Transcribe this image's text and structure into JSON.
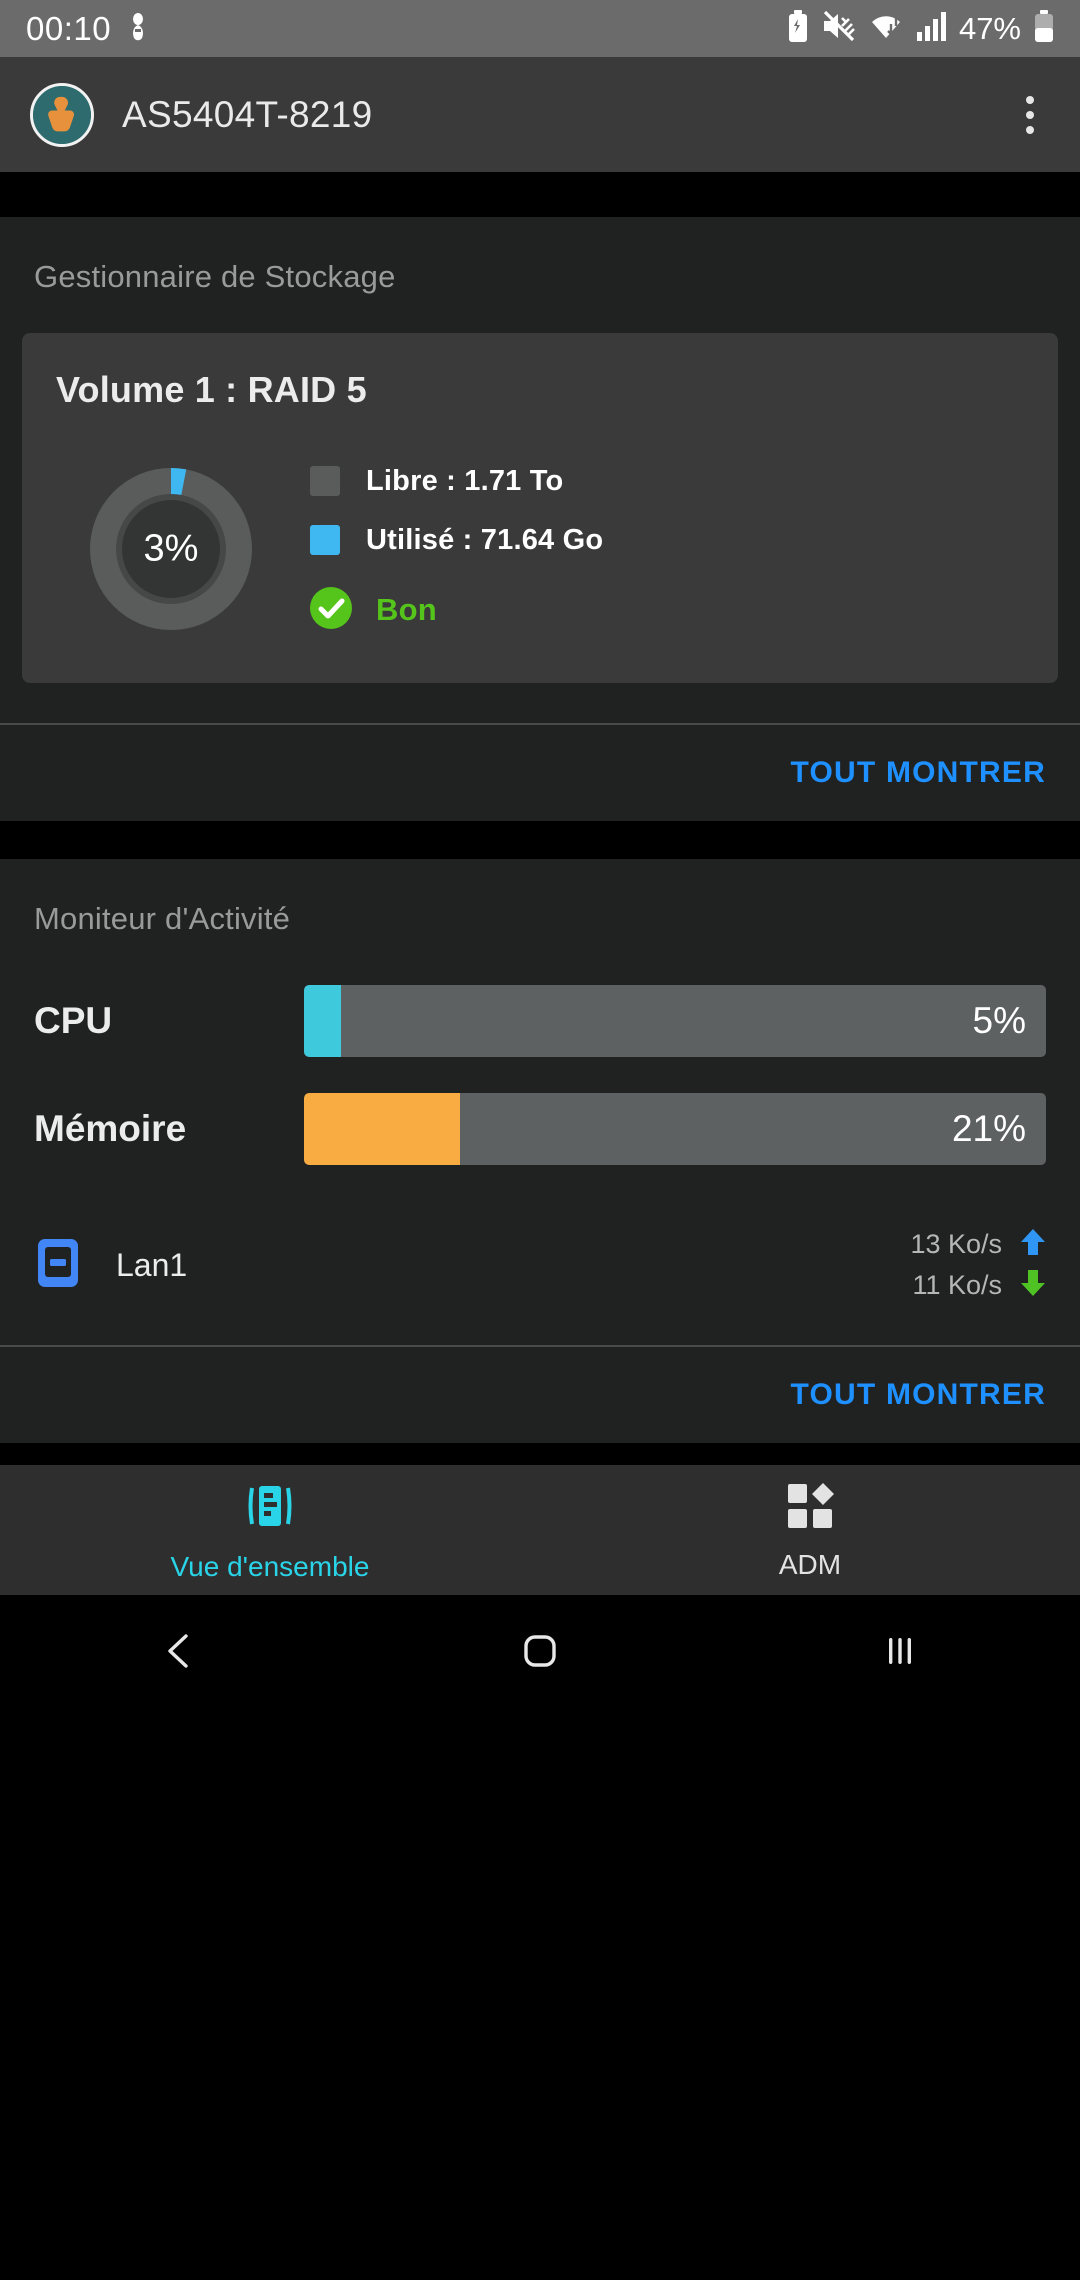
{
  "status_bar": {
    "time": "00:10",
    "battery_percent": "47%",
    "icons": [
      "do-not-disturb-icon",
      "battery-saver-icon",
      "mute-icon",
      "wifi-icon",
      "signal-icon",
      "battery-icon"
    ]
  },
  "app_bar": {
    "title": "AS5404T-8219",
    "avatar_name": "asustor-avatar",
    "menu_name": "overflow-menu-button"
  },
  "storage": {
    "section_title": "Gestionnaire de Stockage",
    "volume_title": "Volume 1 : RAID 5",
    "donut_percent_label": "3%",
    "legend": [
      {
        "label": "Libre : 1.71 To",
        "color": "#5a5c5c"
      },
      {
        "label": "Utilisé : 71.64 Go",
        "color": "#3fb8f2"
      }
    ],
    "status_label": "Bon",
    "status_color": "#55c41b",
    "show_all_label": "TOUT MONTRER"
  },
  "activity": {
    "section_title": "Moniteur d'Activité",
    "meters": [
      {
        "label": "CPU",
        "value_label": "5%",
        "percent": 5,
        "color": "#3fc9dd"
      },
      {
        "label": "Mémoire",
        "value_label": "21%",
        "percent": 21,
        "color": "#f8ac41"
      }
    ],
    "network": {
      "icon_name": "lan-port-icon",
      "name": "Lan1",
      "upload_rate": "13 Ko/s",
      "download_rate": "11 Ko/s",
      "upload_color": "#2f96f5",
      "download_color": "#4fc224"
    },
    "show_all_label": "TOUT MONTRER"
  },
  "bottom_nav": {
    "items": [
      {
        "label": "Vue d'ensemble",
        "icon": "overview-dashboard-icon",
        "active": true,
        "color": "#2ad4e8"
      },
      {
        "label": "ADM",
        "icon": "adm-grid-icon",
        "active": false,
        "color": "#e3e3e3"
      }
    ]
  },
  "android_nav": {
    "back": "back-nav-button",
    "home": "home-nav-button",
    "recents": "recents-nav-button"
  },
  "theme": {
    "accent_blue": "#1e90ff",
    "card_bg": "#3a3a3a",
    "section_bg": "#202222",
    "appbar_bg": "#3a3a3a"
  },
  "chart_data": {
    "type": "pie",
    "title": "Volume 1 : RAID 5",
    "categories": [
      "Utilisé",
      "Libre"
    ],
    "values": [
      3,
      97
    ],
    "value_labels": [
      "71.64 Go",
      "1.71 To"
    ],
    "colors": [
      "#3fb8f2",
      "#5a5c5c"
    ],
    "center_label": "3%",
    "legend_position": "right"
  }
}
